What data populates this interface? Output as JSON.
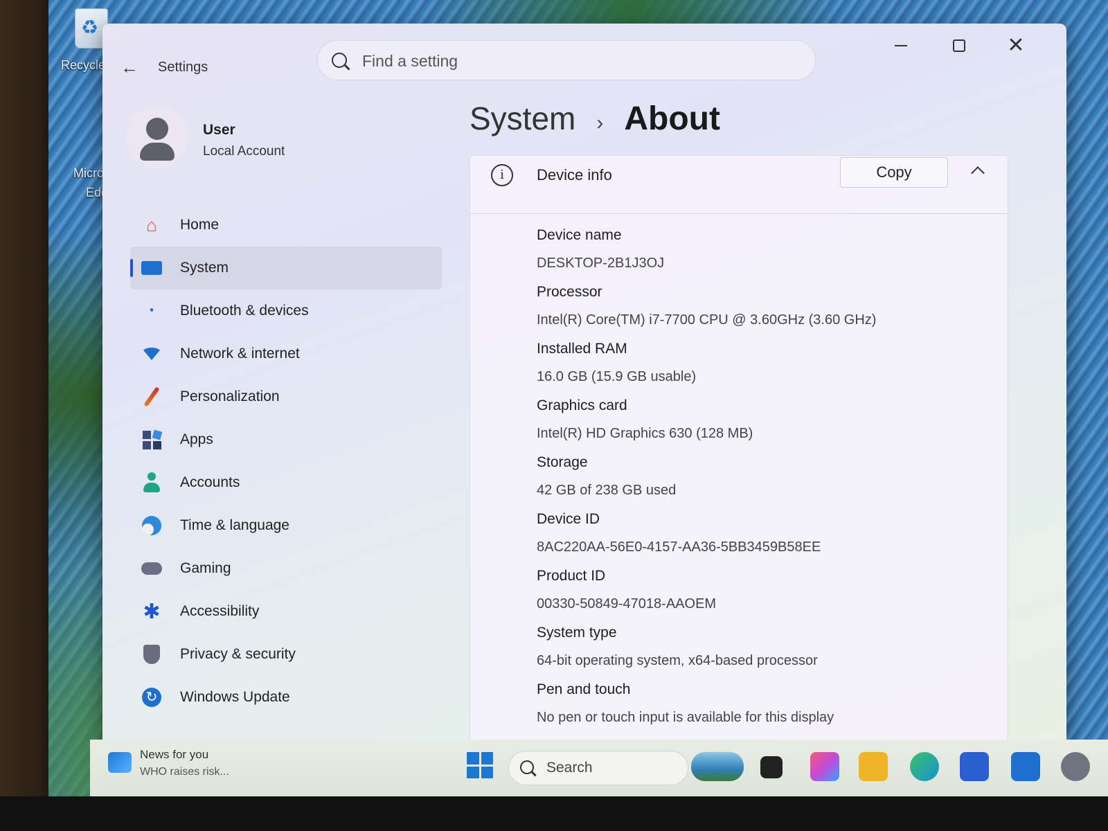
{
  "desktop": {
    "recycle_label": "Recycle",
    "edge_label_1": "Micro",
    "edge_label_2": "Edg"
  },
  "window": {
    "app_title": "Settings",
    "search_placeholder": "Find a setting"
  },
  "user": {
    "name": "User",
    "account_type": "Local Account"
  },
  "sidebar": {
    "items": [
      {
        "label": "Home",
        "icon": "home-icon",
        "color": "#e0523f"
      },
      {
        "label": "System",
        "icon": "monitor-icon",
        "color": "#1f6fd1",
        "active": true
      },
      {
        "label": "Bluetooth & devices",
        "icon": "bluetooth-icon",
        "color": "#1f6fd1"
      },
      {
        "label": "Network & internet",
        "icon": "wifi-icon",
        "color": "#1f6fd1"
      },
      {
        "label": "Personalization",
        "icon": "brush-icon",
        "color": "#d8622b"
      },
      {
        "label": "Apps",
        "icon": "apps-icon",
        "color": "#3a4a7a"
      },
      {
        "label": "Accounts",
        "icon": "person-icon",
        "color": "#1fa58a"
      },
      {
        "label": "Time & language",
        "icon": "globe-clock-icon",
        "color": "#2d8ad8"
      },
      {
        "label": "Gaming",
        "icon": "gamepad-icon",
        "color": "#6c6c86"
      },
      {
        "label": "Accessibility",
        "icon": "accessibility-icon",
        "color": "#1f55c8"
      },
      {
        "label": "Privacy & security",
        "icon": "shield-icon",
        "color": "#6b6b7e"
      },
      {
        "label": "Windows Update",
        "icon": "refresh-icon",
        "color": "#1f6fd1"
      }
    ]
  },
  "breadcrumb": {
    "parent": "System",
    "separator": "›",
    "current": "About"
  },
  "device_info": {
    "title": "Device info",
    "copy_label": "Copy",
    "specs": [
      {
        "label": "Device name",
        "value": "DESKTOP-2B1J3OJ"
      },
      {
        "label": "Processor",
        "value": "Intel(R) Core(TM) i7-7700 CPU @ 3.60GHz (3.60 GHz)"
      },
      {
        "label": "Installed RAM",
        "value": "16.0 GB (15.9 GB usable)"
      },
      {
        "label": "Graphics card",
        "value": "Intel(R) HD Graphics 630 (128 MB)"
      },
      {
        "label": "Storage",
        "value": "42 GB of 238 GB used"
      },
      {
        "label": "Device ID",
        "value": "8AC220AA-56E0-4157-AA36-5BB3459B58EE"
      },
      {
        "label": "Product ID",
        "value": "00330-50849-47018-AAOEM"
      },
      {
        "label": "System type",
        "value": "64-bit operating system, x64-based processor"
      },
      {
        "label": "Pen and touch",
        "value": "No pen or touch input is available for this display"
      }
    ]
  },
  "taskbar": {
    "news_title": "News for you",
    "news_sub": "WHO raises risk...",
    "search_label": "Search",
    "apps": [
      {
        "name": "widgets",
        "color": "#2f7fb6"
      },
      {
        "name": "task-view",
        "color": "#222222"
      },
      {
        "name": "m365",
        "color": "#c24bd8"
      },
      {
        "name": "file-explorer",
        "color": "#f0b429"
      },
      {
        "name": "edge",
        "color": "#1a8fd1"
      },
      {
        "name": "store",
        "color": "#2a5fd0"
      },
      {
        "name": "outlook",
        "color": "#1f6fd1"
      },
      {
        "name": "settings",
        "color": "#6e7480"
      }
    ]
  }
}
